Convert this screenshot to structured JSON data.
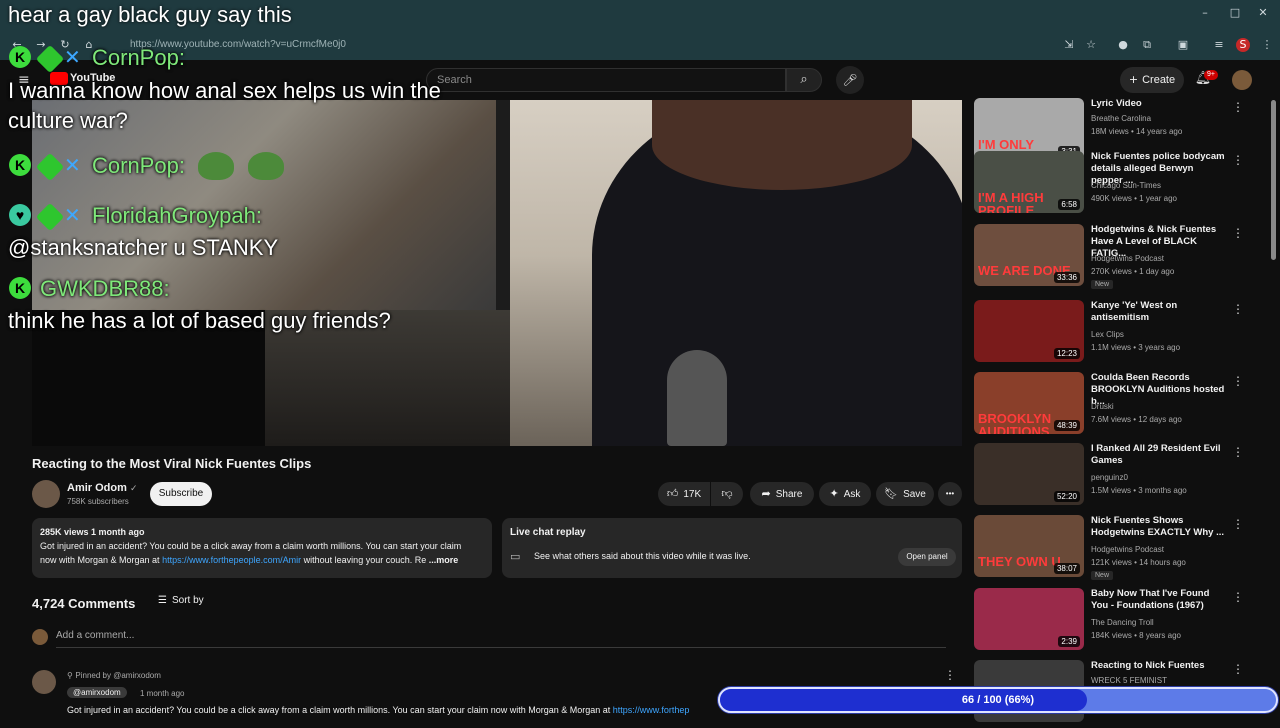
{
  "browser": {
    "url": "https://www.youtube.com/watch?v=uCrmcfMe0j0",
    "window_controls": {
      "minimize": "–",
      "maximize": "□",
      "close": "✕"
    }
  },
  "stream_overlay_title": "hear a gay black guy say this",
  "youtube": {
    "logo_text": "YouTube",
    "search_placeholder": "Search",
    "create_label": "Create",
    "notifications_badge": "9+"
  },
  "chat_messages": [
    {
      "user": "CornPop:",
      "text": "I wanna know how anal sex helps us win the culture war?"
    },
    {
      "user": "CornPop:",
      "text": ""
    },
    {
      "user": "FloridahGroypah:",
      "text": "@stanksnatcher u STANKY"
    },
    {
      "user": "GWKDBR88:",
      "text": "think he has a lot of based guy friends?"
    }
  ],
  "video": {
    "title": "Reacting to the Most Viral Nick Fuentes Clips",
    "channel": "Amir Odom",
    "subscribers": "758K subscribers",
    "subscribe_label": "Subscribe",
    "likes": "17K",
    "share_label": "Share",
    "ask_label": "Ask",
    "save_label": "Save",
    "more_label": "•••"
  },
  "description": {
    "meta": "285K views  1 month ago",
    "line1": "Got injured in an accident? You could be a click away from a claim worth millions. You can start your claim",
    "line2_prefix": "now with Morgan & Morgan at",
    "link": "https://www.forthepeople.com/Amir",
    "line2_suffix": "without leaving your couch. Re",
    "more": "...more"
  },
  "live_chat": {
    "title": "Live chat replay",
    "subtitle": "See what others said about this video while it was live.",
    "button": "Open panel"
  },
  "comments": {
    "count": "4,724 Comments",
    "sort_label": "Sort by",
    "add_placeholder": "Add a comment...",
    "pinned_label": "Pinned by @amirxodom",
    "first_user": "@amirxodom",
    "first_time": "1 month ago",
    "first_text": "Got injured in an accident? You could be a click away from a claim worth millions. You can start your claim now with Morgan & Morgan at",
    "first_link": "https://www.forthep"
  },
  "recommendations": [
    {
      "title": "Lyric Video",
      "channel": "Breathe Carolina",
      "meta": "18M views • 14 years ago",
      "duration": "3:31",
      "thumb_text": "I'M ONLY GETTIN' STARTED",
      "color": "#a9a9a9",
      "new": ""
    },
    {
      "title": "Nick Fuentes police bodycam details alleged Berwyn pepper ...",
      "channel": "Chicago Sun-Times",
      "meta": "490K views • 1 year ago",
      "duration": "6:58",
      "thumb_text": "I'M A HIGH PROFILE PERSON...",
      "color": "#4a4f46",
      "new": ""
    },
    {
      "title": "Hodgetwins & Nick Fuentes Have A Level of BLACK FATIG...",
      "channel": "Hodgetwins Podcast",
      "meta": "270K views • 1 day ago",
      "duration": "33:36",
      "thumb_text": "WE ARE DONE",
      "color": "#6e4e3e",
      "new": "New"
    },
    {
      "title": "Kanye 'Ye' West on antisemitism",
      "channel": "Lex Clips",
      "meta": "1.1M views • 3 years ago",
      "duration": "12:23",
      "thumb_text": "",
      "color": "#7a1b1b",
      "new": ""
    },
    {
      "title": "Coulda Been Records BROOKLYN Auditions hosted b...",
      "channel": "Druski",
      "meta": "7.6M views • 12 days ago",
      "duration": "48:39",
      "thumb_text": "BROOKLYN AUDITIONS",
      "color": "#8a3f2a",
      "new": ""
    },
    {
      "title": "I Ranked All 29 Resident Evil Games",
      "channel": "penguinz0",
      "meta": "1.5M views • 3 months ago",
      "duration": "52:20",
      "thumb_text": "",
      "color": "#3a2f28",
      "new": ""
    },
    {
      "title": "Nick Fuentes Shows Hodgetwins EXACTLY Why ...",
      "channel": "Hodgetwins Podcast",
      "meta": "121K views • 14 hours ago",
      "duration": "38:07",
      "thumb_text": "THEY OWN U",
      "color": "#6a4a38",
      "new": "New"
    },
    {
      "title": "Baby Now That I've Found You - Foundations (1967)",
      "channel": "The Dancing Troll",
      "meta": "184K views • 8 years ago",
      "duration": "2:39",
      "thumb_text": "",
      "color": "#9a2a4a",
      "new": ""
    },
    {
      "title": "Reacting to Nick Fuentes",
      "channel": "WRECK 5 FEMINIST",
      "meta": "",
      "duration": "",
      "thumb_text": "",
      "color": "#3a3a3a",
      "new": ""
    }
  ],
  "progress": {
    "label": "66 / 100 (66%)",
    "value": 0.66
  }
}
